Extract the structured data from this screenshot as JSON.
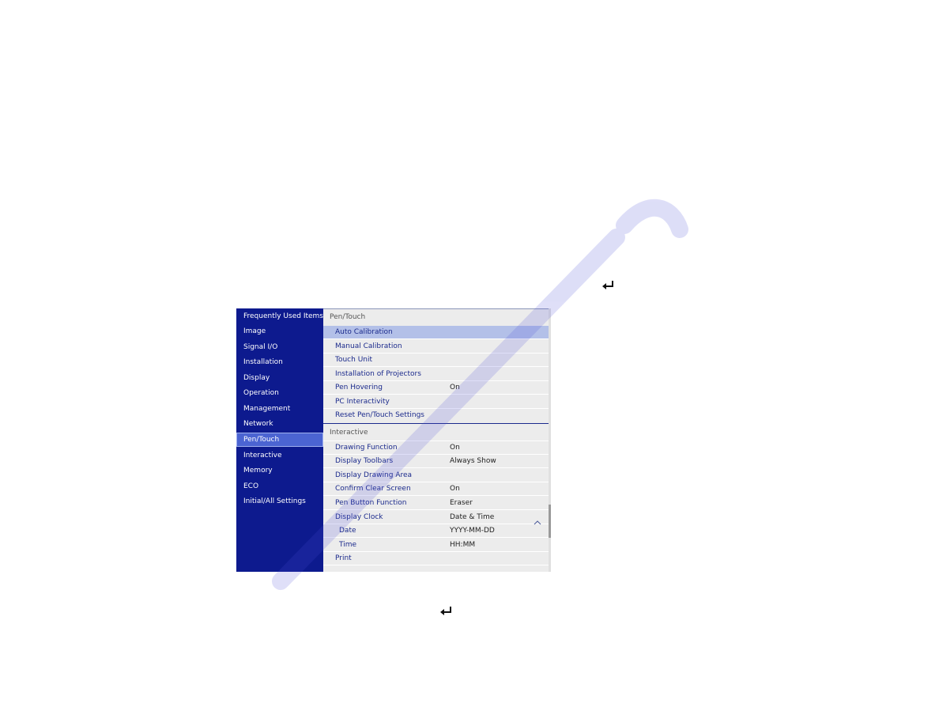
{
  "icons": {
    "enter_top": "enter-key-icon",
    "enter_bottom": "enter-key-icon"
  },
  "sidebar": {
    "items": [
      {
        "label": "Frequently Used Items",
        "active": false
      },
      {
        "label": "Image",
        "active": false
      },
      {
        "label": "Signal I/O",
        "active": false
      },
      {
        "label": "Installation",
        "active": false
      },
      {
        "label": "Display",
        "active": false
      },
      {
        "label": "Operation",
        "active": false
      },
      {
        "label": "Management",
        "active": false
      },
      {
        "label": "Network",
        "active": false
      },
      {
        "label": "Pen/Touch",
        "active": true
      },
      {
        "label": "Interactive",
        "active": false
      },
      {
        "label": "Memory",
        "active": false
      },
      {
        "label": "ECO",
        "active": false
      },
      {
        "label": "Initial/All Settings",
        "active": false
      }
    ]
  },
  "panel": {
    "sections": [
      {
        "header": "Pen/Touch",
        "rows": [
          {
            "label": "Auto Calibration",
            "value": "",
            "selected": true
          },
          {
            "label": "Manual Calibration",
            "value": ""
          },
          {
            "label": "Touch Unit",
            "value": ""
          },
          {
            "label": "Installation of Projectors",
            "value": ""
          },
          {
            "label": "Pen Hovering",
            "value": "On"
          },
          {
            "label": "PC Interactivity",
            "value": ""
          },
          {
            "label": "Reset Pen/Touch Settings",
            "value": ""
          }
        ]
      },
      {
        "header": "Interactive",
        "rows": [
          {
            "label": "Drawing Function",
            "value": "On"
          },
          {
            "label": "Display Toolbars",
            "value": "Always Show"
          },
          {
            "label": "Display Drawing Area",
            "value": ""
          },
          {
            "label": "Confirm Clear Screen",
            "value": "On"
          },
          {
            "label": "Pen Button Function",
            "value": "Eraser"
          },
          {
            "label": "Display Clock",
            "value": "Date & Time",
            "expanded": true
          },
          {
            "label": "Date",
            "value": "YYYY-MM-DD",
            "sub": true
          },
          {
            "label": "Time",
            "value": "HH:MM",
            "sub": true
          },
          {
            "label": "Print",
            "value": ""
          }
        ]
      }
    ]
  },
  "colors": {
    "sidebar_bg": "#0d1a8e",
    "sidebar_active": "#4b64d2",
    "row_selected": "#b3c0e8",
    "label_text": "#1b2a8c",
    "panel_bg": "#ececec"
  }
}
